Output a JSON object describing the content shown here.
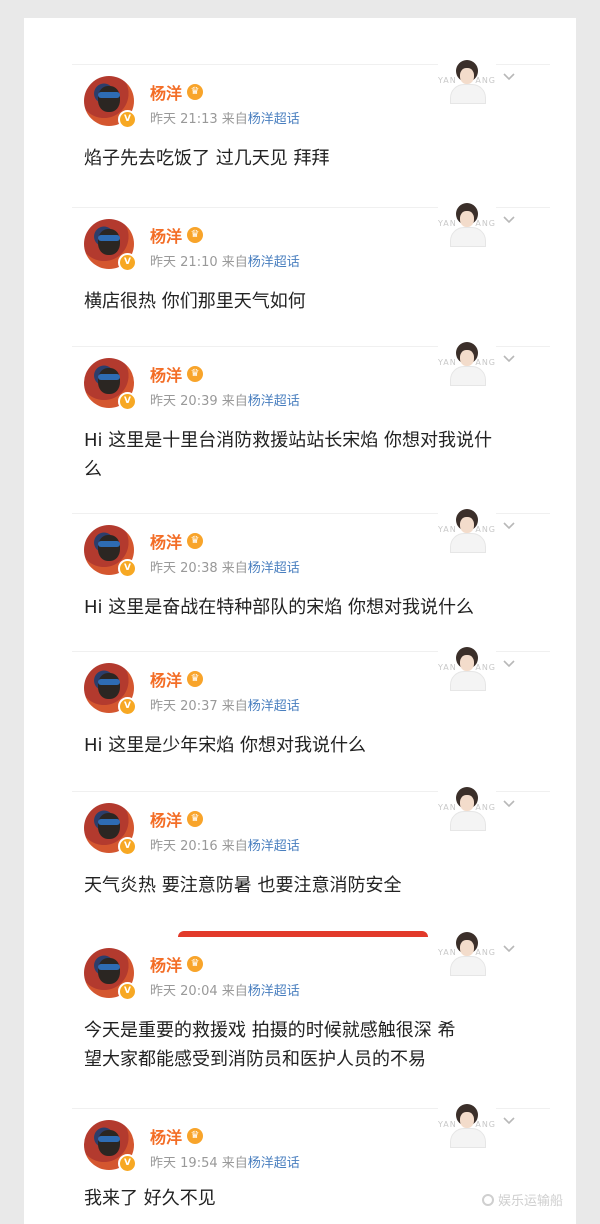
{
  "colors": {
    "name": "#f36d26",
    "meta": "#999999",
    "source_link": "#4a7fbf",
    "badge": "#f7a823",
    "accent_bar": "#e23a2a"
  },
  "card_text": {
    "left": "YAN",
    "right": "ANG"
  },
  "posts": [
    {
      "author": "杨洋",
      "day": "昨天",
      "time": "21:13",
      "source_prefix": "来自",
      "source": "杨洋超话",
      "content": "焰子先去吃饭了 过几天见 拜拜"
    },
    {
      "author": "杨洋",
      "day": "昨天",
      "time": "21:10",
      "source_prefix": "来自",
      "source": "杨洋超话",
      "content": "横店很热 你们那里天气如何"
    },
    {
      "author": "杨洋",
      "day": "昨天",
      "time": "20:39",
      "source_prefix": "来自",
      "source": "杨洋超话",
      "content": "Hi 这里是十里台消防救援站站长宋焰 你想对我说什么"
    },
    {
      "author": "杨洋",
      "day": "昨天",
      "time": "20:38",
      "source_prefix": "来自",
      "source": "杨洋超话",
      "content": "Hi 这里是奋战在特种部队的宋焰 你想对我说什么"
    },
    {
      "author": "杨洋",
      "day": "昨天",
      "time": "20:37",
      "source_prefix": "来自",
      "source": "杨洋超话",
      "content": "Hi 这里是少年宋焰 你想对我说什么"
    },
    {
      "author": "杨洋",
      "day": "昨天",
      "time": "20:16",
      "source_prefix": "来自",
      "source": "杨洋超话",
      "content": "天气炎热 要注意防暑 也要注意消防安全"
    },
    {
      "author": "杨洋",
      "day": "昨天",
      "time": "20:04",
      "source_prefix": "来自",
      "source": "杨洋超话",
      "content": "今天是重要的救援戏 拍摄的时候就感触很深 希望大家都能感受到消防员和医护人员的不易"
    },
    {
      "author": "杨洋",
      "day": "昨天",
      "time": "19:54",
      "source_prefix": "来自",
      "source": "杨洋超话",
      "content": "我来了 好久不见"
    }
  ],
  "watermark": "娱乐运输船"
}
